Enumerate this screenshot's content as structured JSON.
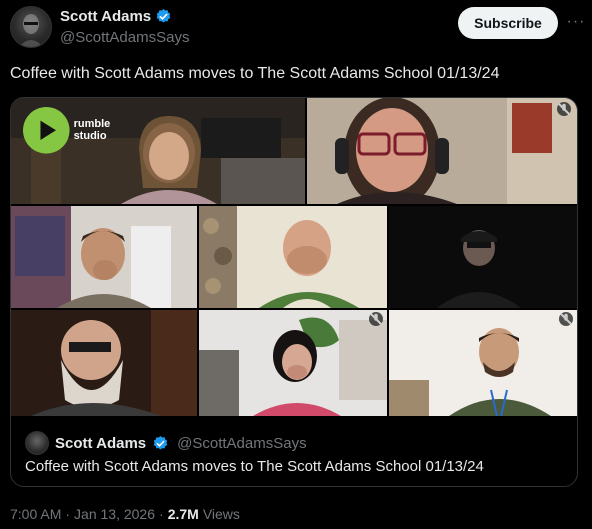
{
  "author": {
    "display_name": "Scott Adams",
    "handle": "@ScottAdamsSays"
  },
  "subscribe_label": "Subscribe",
  "more_label": "···",
  "post_text": "Coffee with Scott Adams moves to The Scott Adams School 01/13/24",
  "media": {
    "brand_label": "rumble studio",
    "tiles": [
      {
        "name": "participant-woman-kitchen"
      },
      {
        "name": "participant-woman-glasses-headphones"
      },
      {
        "name": "participant-man-hand-face"
      },
      {
        "name": "participant-man-bald"
      },
      {
        "name": "participant-man-dark-cap"
      },
      {
        "name": "participant-man-beard-sunglasses"
      },
      {
        "name": "participant-woman-hand-face"
      },
      {
        "name": "participant-man-lanyard"
      }
    ]
  },
  "quoted": {
    "display_name": "Scott Adams",
    "handle": "@ScottAdamsSays",
    "text": "Coffee with Scott Adams moves to The Scott Adams School 01/13/24"
  },
  "meta": {
    "time": "7:00 AM",
    "dot1": "·",
    "date": "Jan 13, 2026",
    "dot2": "·",
    "views_count": "2.7M",
    "views_label": "Views"
  },
  "colors": {
    "verified": "#1d9bf0",
    "rumble_green": "#85c742"
  }
}
